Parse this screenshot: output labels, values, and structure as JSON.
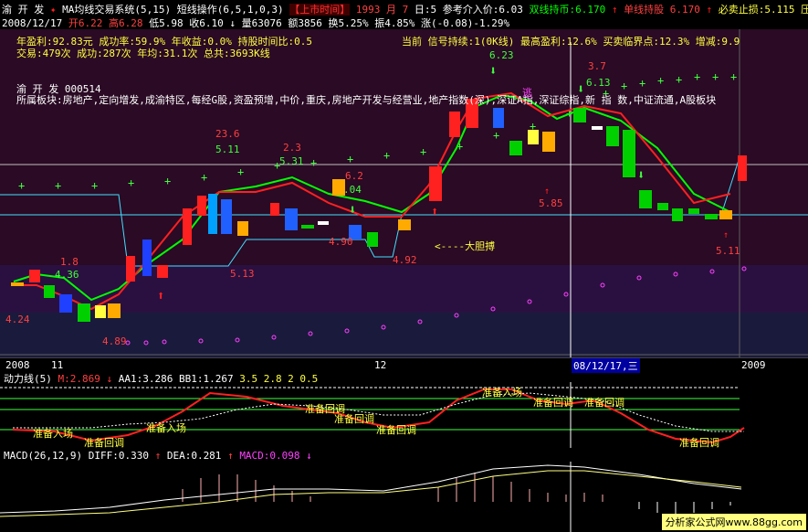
{
  "top_bar": {
    "stock_name": "渝 开 发",
    "strategy": "MA均线交易系统(5,15)",
    "op": "短线操作(6,5,1,0,3)",
    "btn_listing": "【上市时间】",
    "listing_year": "1993",
    "listing_month": "月 7",
    "listing_day": "日:5",
    "ref_price": "参考介入价:6.03",
    "signal_dual": "双线持币:6.170",
    "signal_single": "单线持股 6.170",
    "stop_loss": "必卖止损:5.115",
    "more": "压"
  },
  "quote_bar": {
    "date": "2008/12/17",
    "open": "开6.22",
    "high": "高6.28",
    "low": "低5.98",
    "close": "收6.10",
    "volume": "量63076",
    "amount": "额3856",
    "turnover": "换5.25%",
    "amplitude": "振4.85%",
    "change": "涨(-0.08)-1.29%"
  },
  "stats": {
    "line1": "年盈利:92.83元 成功率:59.9% 年收益:0.0% 持股时间比:0.5",
    "line2": "交易:479次 成功:287次 年均:31.1次 总共:3693K线",
    "current": "当前 信号持续:1(0K线) 最高盈利:12.6% 买卖临界点:12.3% 增减:9.9"
  },
  "stock_info": {
    "title": "渝 开 发 000514",
    "sectors": "所属板块:房地产,定向增发,成渝特区,每经G股,资盈预增,中价,重庆,房地产开发与经营业,地产指数(深),深证A指,深证综指,新 指 数,中证流通,A股板块"
  },
  "price_labels": {
    "p623": "6.23",
    "p613": "6.13",
    "p37": "3.7",
    "p236": "23.6",
    "p511": "5.11",
    "p23": "2.3",
    "p531": "5.31",
    "p62": "6.2",
    "p04": ".04",
    "p585": "5.85",
    "p511b": "5.11",
    "p18": "1.8",
    "p436": "4.36",
    "p424": "4.24",
    "p489": "4.89",
    "p513": "5.13",
    "p492": "4.92",
    "p490": "4.90",
    "bold_note": "<----大胆搏",
    "tao": "逃"
  },
  "time_axis": {
    "y2008": "2008",
    "m11": "11",
    "m12": "12",
    "cursor_date": "08/12/17,三",
    "y2009": "2009"
  },
  "indicator1": {
    "name": "动力线(5)",
    "m": "M:2.869",
    "aa1": "AA1:3.286",
    "bb1": "BB1:1.267",
    "levels": "3.5  2.8  2  0.5",
    "notes": {
      "enter_a": "准备入场",
      "enter_b": "准备入场",
      "enter_c": "准备入场",
      "pull_a": "准备回调",
      "pull_b": "准备回调",
      "pull_c": "准备回调",
      "pull_d": "准备回调",
      "pull_e": "准备回调",
      "pull_f": "准备回调",
      "pull_g": "准备回调"
    }
  },
  "indicator2": {
    "name": "MACD(26,12,9)",
    "diff": "DIFF:0.330",
    "dea": "DEA:0.281",
    "macd": "MACD:0.098"
  },
  "watermark": "分析家公式网www.88gg.com",
  "colors": {
    "up": "#ff2020",
    "down": "#00d000",
    "bg_purple": "#3a1030",
    "accent_yellow": "#ffff00",
    "cyan": "#40e0ff",
    "magenta": "#ff40ff"
  }
}
